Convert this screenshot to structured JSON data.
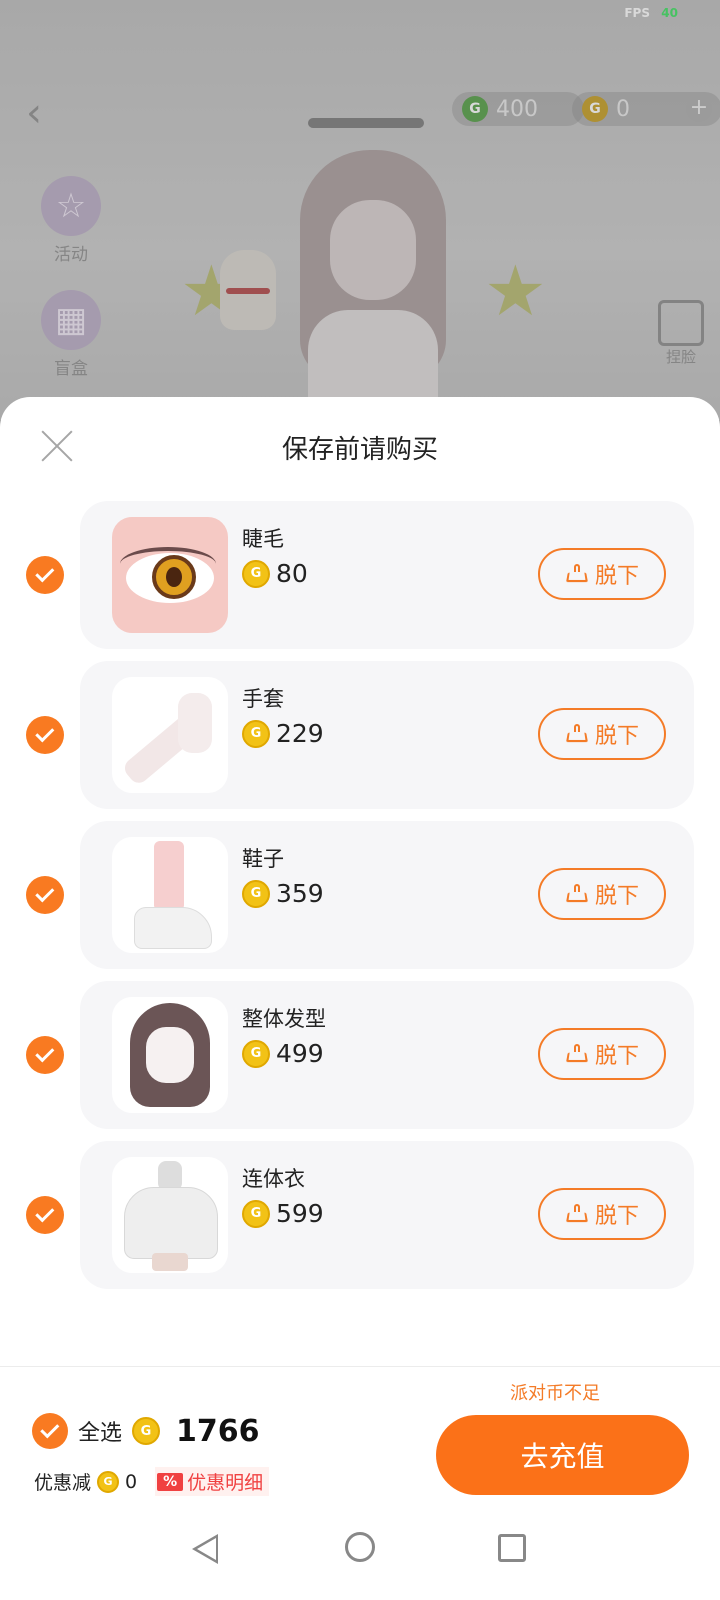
{
  "status_bar": {
    "fps_label": "FPS",
    "fps_value": "40"
  },
  "scene": {
    "currency_green_value": "400",
    "currency_gold_value": "0",
    "side_buttons": [
      "活动",
      "盲盒"
    ],
    "right_button": "捏脸"
  },
  "sheet": {
    "title": "保存前请购买",
    "remove_label": "脱下",
    "items": [
      {
        "name": "睫毛",
        "price": "80",
        "checked": true
      },
      {
        "name": "手套",
        "price": "229",
        "checked": true
      },
      {
        "name": "鞋子",
        "price": "359",
        "checked": true
      },
      {
        "name": "整体发型",
        "price": "499",
        "checked": true
      },
      {
        "name": "连体衣",
        "price": "599",
        "checked": true
      }
    ]
  },
  "footer": {
    "insufficient_notice": "派对币不足",
    "select_all_label": "全选",
    "total": "1766",
    "discount_label": "优惠减",
    "discount_value": "0",
    "discount_badge": "%",
    "discount_detail": "优惠明细",
    "recharge_label": "去充值"
  },
  "colors": {
    "accent": "#f97a21",
    "coin": "#f2c216",
    "discount_red": "#f04141"
  }
}
